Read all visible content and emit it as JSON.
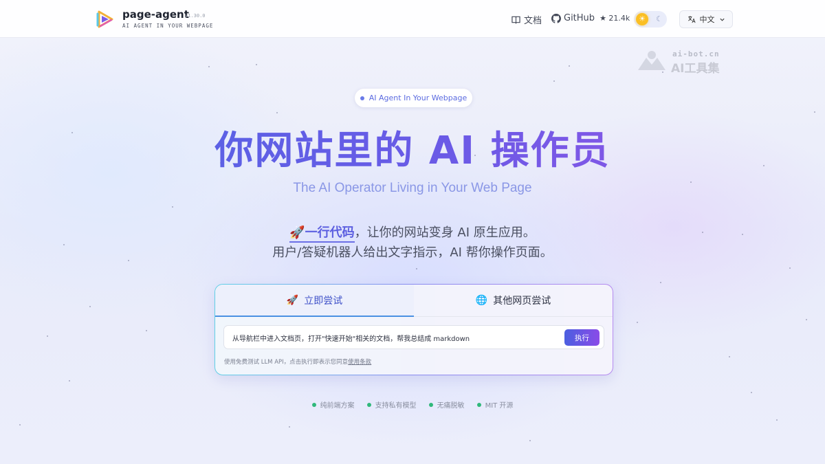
{
  "header": {
    "brand_name": "page-agent",
    "version": "v1.30.0",
    "tagline": "AI AGENT IN YOUR WEBPAGE",
    "docs_label": "文档",
    "github_label": "GitHub",
    "github_stars": "★ 21.4k",
    "theme": {
      "sun_icon": "☀",
      "moon_icon": "☾"
    },
    "language_label": "中文"
  },
  "watermark": {
    "top_text": "ai-bot.cn",
    "bottom_text": "AI工具集"
  },
  "hero": {
    "pill_text": "AI Agent In Your Webpage",
    "title": "你网站里的 AI 操作员",
    "subtitle": "The AI Operator Living in Your Web Page",
    "desc_highlight": "🚀一行代码",
    "desc_line1_rest": "，让你的网站变身 AI 原生应用。",
    "desc_line2": "用户/答疑机器人给出文字指示，AI 帮你操作页面。"
  },
  "demo": {
    "tabs": [
      {
        "label": "立即尝试",
        "icon": "🚀",
        "active": true
      },
      {
        "label": "其他网页尝试",
        "icon": "🌐",
        "active": false
      }
    ],
    "task_value": "从导航栏中进入文档页，打开\"快速开始\"相关的文档，帮我总结成 markdown",
    "run_label": "执行",
    "note_prefix": "使用免费测试 LLM API，点击执行即表示您同意",
    "note_link": "使用条款"
  },
  "features": [
    "纯前端方案",
    "支持私有模型",
    "无痛脱敏",
    "MIT 开源"
  ],
  "colors": {
    "accent": "#5c6be0",
    "title_gradient_start": "#4f66e4",
    "title_gradient_end": "#9b55e6",
    "feature_dot": "#2fb87a"
  }
}
